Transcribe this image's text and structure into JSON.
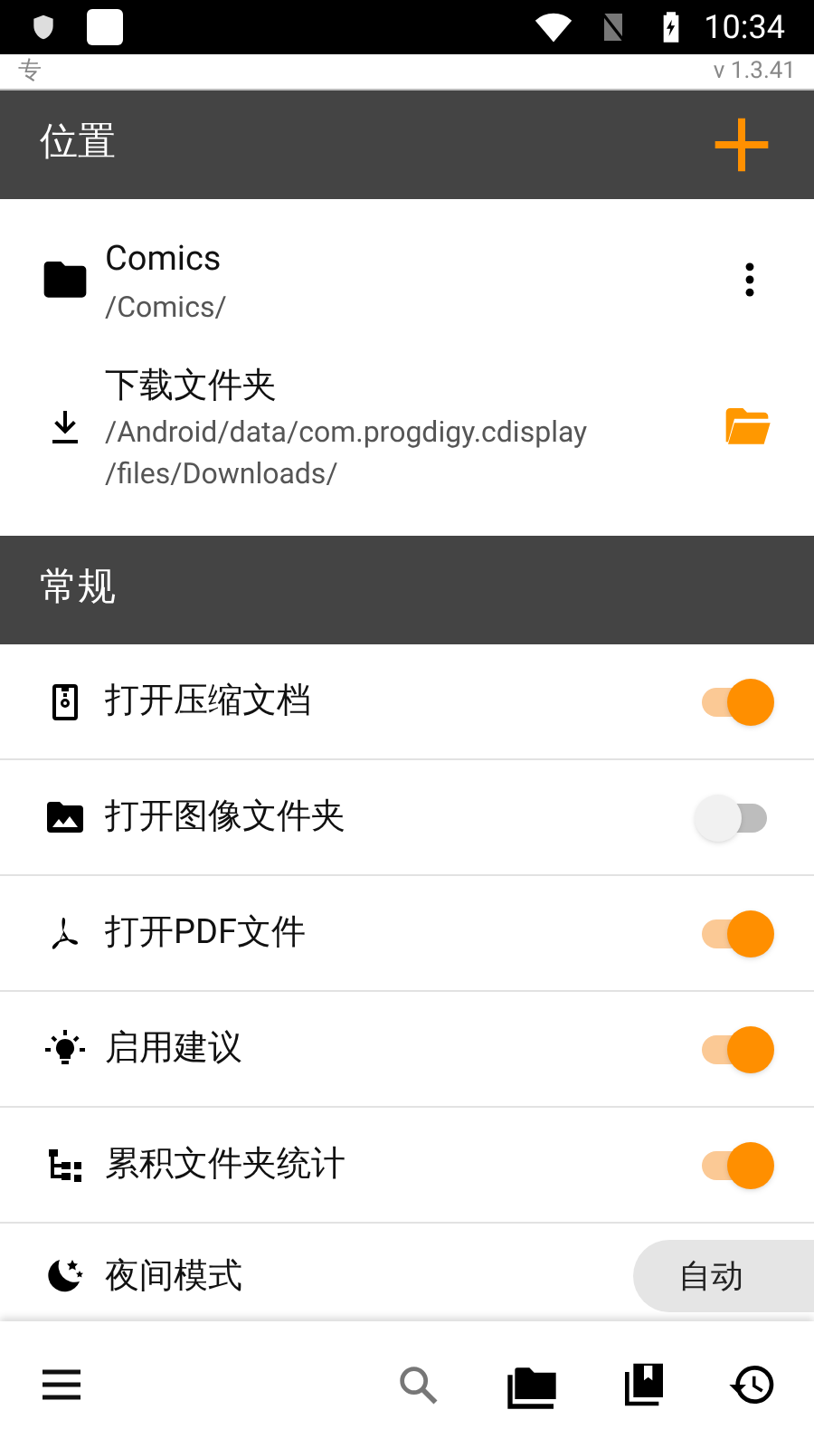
{
  "status_bar": {
    "time": "10:34"
  },
  "top_strip": {
    "left_text": "专",
    "version": "v 1.3.41"
  },
  "locations_section": {
    "title": "位置",
    "items": [
      {
        "kind": "folder",
        "name": "Comics",
        "path": "/Comics/"
      },
      {
        "kind": "download",
        "name": "下载文件夹",
        "path": "/Android/data/com.progdigy.cdisplay/files/Downloads/"
      }
    ]
  },
  "general_section": {
    "title": "常规",
    "items": [
      {
        "kind": "toggle",
        "label": "打开压缩文档",
        "on": true
      },
      {
        "kind": "toggle",
        "label": "打开图像文件夹",
        "on": false
      },
      {
        "kind": "toggle",
        "label": "打开PDF文件",
        "on": true
      },
      {
        "kind": "toggle",
        "label": "启用建议",
        "on": true
      },
      {
        "kind": "toggle",
        "label": "累积文件夹统计",
        "on": true
      },
      {
        "kind": "choice",
        "label": "夜间模式",
        "value": "自动"
      }
    ]
  }
}
